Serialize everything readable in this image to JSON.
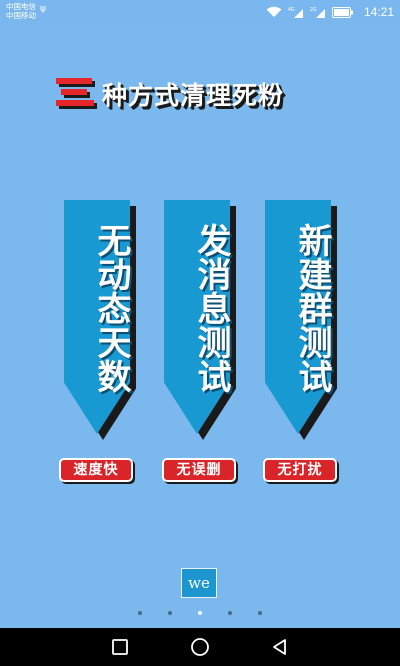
{
  "status_bar": {
    "carrier_1": "中国电信",
    "carrier_2": "中国移动",
    "network_1": "4G",
    "network_2": "2G",
    "time": "14:21",
    "icons": [
      "usb-icon",
      "wifi-icon",
      "signal-icon",
      "battery-icon"
    ]
  },
  "title": {
    "number_mark": "三",
    "text": "种方式清理死粉"
  },
  "banners": [
    {
      "text": "无动态天数"
    },
    {
      "text": "发消息测试"
    },
    {
      "text": "新建群测试"
    }
  ],
  "tags": [
    {
      "text": "速度快"
    },
    {
      "text": "无误删"
    },
    {
      "text": "无打扰"
    }
  ],
  "logo": {
    "text": "we"
  },
  "pager": {
    "count": 5,
    "active_index": 2
  },
  "colors": {
    "background": "#7ab8ee",
    "banner": "#1999d2",
    "tag": "#d9252a",
    "title_accent": "#e6262a"
  },
  "nav": {
    "icons": [
      "back-square-icon",
      "home-circle-icon",
      "back-triangle-icon"
    ]
  }
}
